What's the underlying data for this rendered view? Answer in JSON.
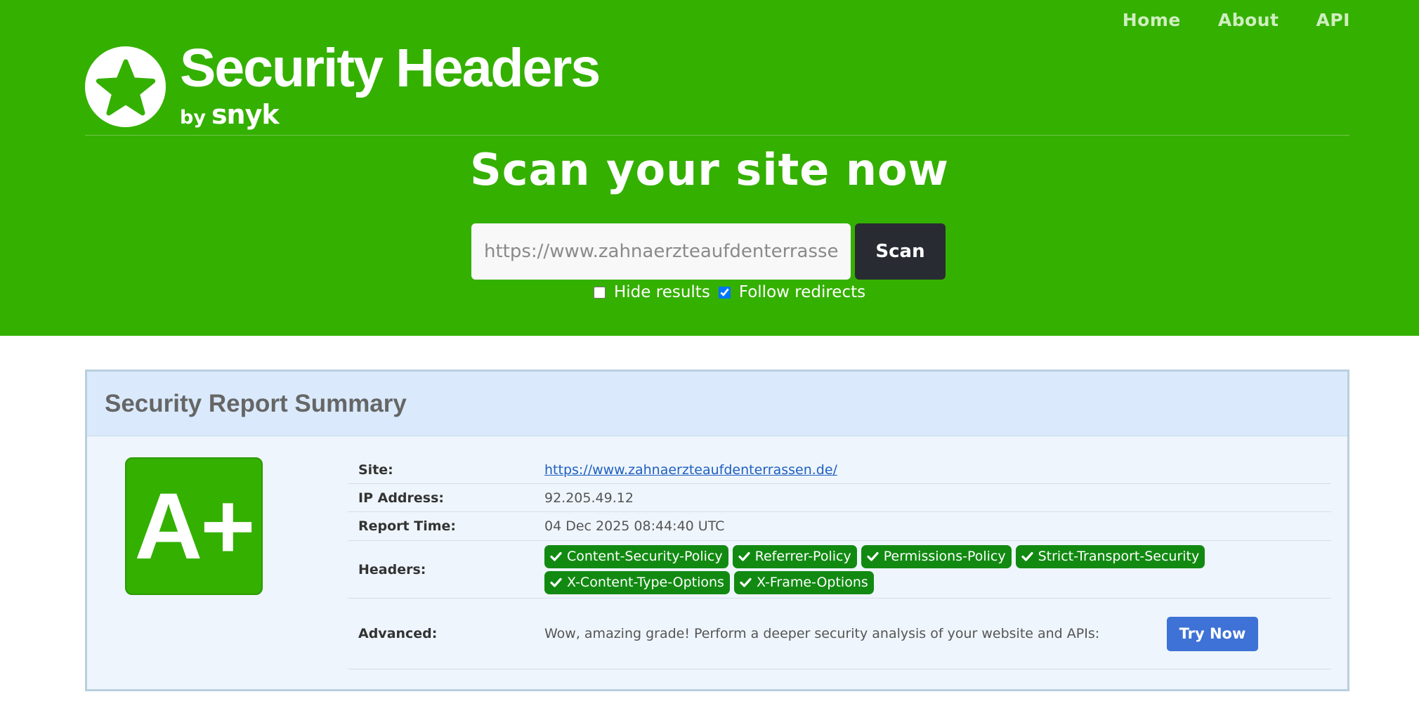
{
  "nav": {
    "items": [
      {
        "label": "Home"
      },
      {
        "label": "About"
      },
      {
        "label": "API"
      }
    ]
  },
  "logo": {
    "title": "Security Headers",
    "by": "by",
    "brand": "snyk",
    "icon": "star-icon"
  },
  "hero": {
    "title": "Scan your site now"
  },
  "scan": {
    "placeholder": "https://www.zahnaerzteaufdenterrassen.de/",
    "button_label": "Scan",
    "hide_results": {
      "label": "Hide results",
      "checked": false
    },
    "follow_redirects": {
      "label": "Follow redirects",
      "checked": true
    }
  },
  "report": {
    "title": "Security Report Summary",
    "grade": "A+",
    "site": {
      "label": "Site:",
      "value": "https://www.zahnaerzteaufdenterrassen.de/"
    },
    "ip": {
      "label": "IP Address:",
      "value": "92.205.49.12"
    },
    "time": {
      "label": "Report Time:",
      "value": "04 Dec 2025 08:44:40 UTC"
    },
    "headers": {
      "label": "Headers:",
      "items": [
        "Content-Security-Policy",
        "Referrer-Policy",
        "Permissions-Policy",
        "Strict-Transport-Security",
        "X-Content-Type-Options",
        "X-Frame-Options"
      ]
    },
    "advanced": {
      "label": "Advanced:",
      "text": "Wow, amazing grade! Perform a deeper security analysis of your website and APIs:",
      "button_label": "Try Now"
    }
  },
  "colors": {
    "brand_green": "#34b000",
    "pill_green": "#128a12",
    "dark_button": "#292b33",
    "blue_button": "#3e72d6"
  }
}
